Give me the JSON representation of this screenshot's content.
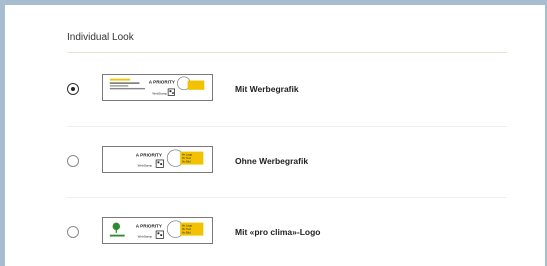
{
  "section": {
    "title": "Individual Look"
  },
  "options": [
    {
      "label": "Mit Werbegrafik",
      "selected": true
    },
    {
      "label": "Ohne Werbegrafik",
      "selected": false
    },
    {
      "label": "Mit «pro clima»-Logo",
      "selected": false
    }
  ],
  "stamp": {
    "brand": "A PRIORITY",
    "brand_small": "A PRIORITY",
    "product": "WebStamp",
    "stamp_text_1": "Ihr Logo",
    "stamp_text_2": "Ihr Text",
    "stamp_text_3": "Ihr Bild"
  },
  "colors": {
    "frame": "#a8bdd0",
    "divider": "#e7e6cf",
    "badge": "#f2c200",
    "logo_green": "#2e8b2e"
  }
}
